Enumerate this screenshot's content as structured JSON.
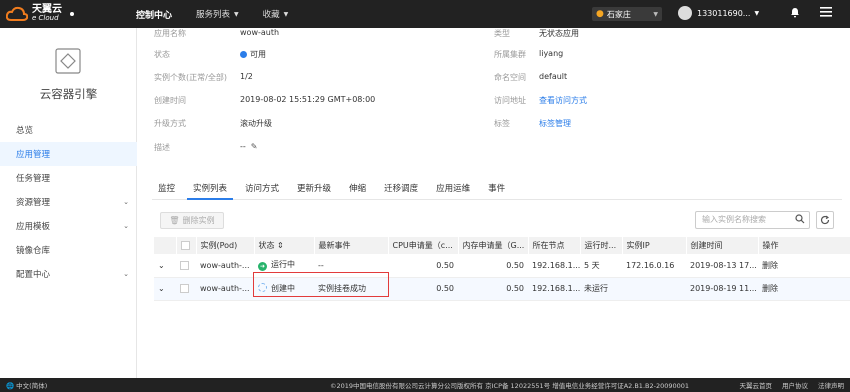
{
  "topbar": {
    "brand_cn": "天翼云",
    "brand_en": "e Cloud",
    "nav": [
      "控制中心",
      "服务列表",
      "收藏"
    ],
    "region": "石家庄",
    "user": "133011690..."
  },
  "sidebar": {
    "title": "云容器引擎",
    "items": [
      {
        "label": "总览",
        "expandable": false
      },
      {
        "label": "应用管理",
        "expandable": false,
        "active": true
      },
      {
        "label": "任务管理",
        "expandable": false
      },
      {
        "label": "资源管理",
        "expandable": true
      },
      {
        "label": "应用模板",
        "expandable": true
      },
      {
        "label": "镜像仓库",
        "expandable": false
      },
      {
        "label": "配置中心",
        "expandable": true
      }
    ]
  },
  "info": {
    "app_name_label": "应用名称",
    "app_name": "wow-auth",
    "status_label": "状态",
    "status": "可用",
    "instances_label": "实例个数(正常/全部)",
    "instances": "1/2",
    "created_label": "创建时间",
    "created": "2019-08-02 15:51:29 GMT+08:00",
    "upgrade_label": "升级方式",
    "upgrade": "滚动升级",
    "desc_label": "描述",
    "desc": "--",
    "type_label": "类型",
    "type": "无状态应用",
    "cluster_label": "所属集群",
    "cluster": "liyang",
    "namespace_label": "命名空间",
    "namespace": "default",
    "access_label": "访问地址",
    "access": "查看访问方式",
    "tags_label": "标签",
    "tags": "标签管理"
  },
  "tabs": [
    "监控",
    "实例列表",
    "访问方式",
    "更新升级",
    "伸缩",
    "迁移调度",
    "应用运维",
    "事件"
  ],
  "active_tab": "实例列表",
  "toolbar": {
    "delete_label": "删除实例",
    "search_placeholder": "输入实例名称搜索"
  },
  "table": {
    "headers": [
      "",
      "",
      "实例(Pod)",
      "状态 ⇕",
      "最新事件",
      "CPU申请量（c...",
      "内存申请量（G...",
      "所在节点",
      "运行时...",
      "实例IP",
      "创建时间",
      "操作"
    ],
    "rows": [
      {
        "name": "wow-auth-...",
        "status": "运行中",
        "event": "--",
        "cpu": "0.50",
        "mem": "0.50",
        "node": "192.168.1...",
        "runtime": "5 天",
        "ip": "172.16.0.16",
        "created": "2019-08-13 17...",
        "action": "删除"
      },
      {
        "name": "wow-auth-...",
        "status": "创建中",
        "event": "实例挂卷成功",
        "cpu": "0.50",
        "mem": "0.50",
        "node": "192.168.1...",
        "runtime": "未运行",
        "ip": "",
        "created": "2019-08-19 11...",
        "action": "删除"
      }
    ]
  },
  "footer": {
    "lang": "中文(简体)",
    "copyright": "©2019中国电信股份有限公司云计算分公司版权所有  京ICP备 12022551号  增值电信业务经营许可证A2.B1.B2-20090001",
    "links": [
      "天翼云首页",
      "用户协议",
      "法律声明"
    ]
  },
  "colors": {
    "accent": "#2b7de9",
    "topbar": "#222222",
    "running": "#27b36b",
    "highlight": "#e23b3b"
  }
}
